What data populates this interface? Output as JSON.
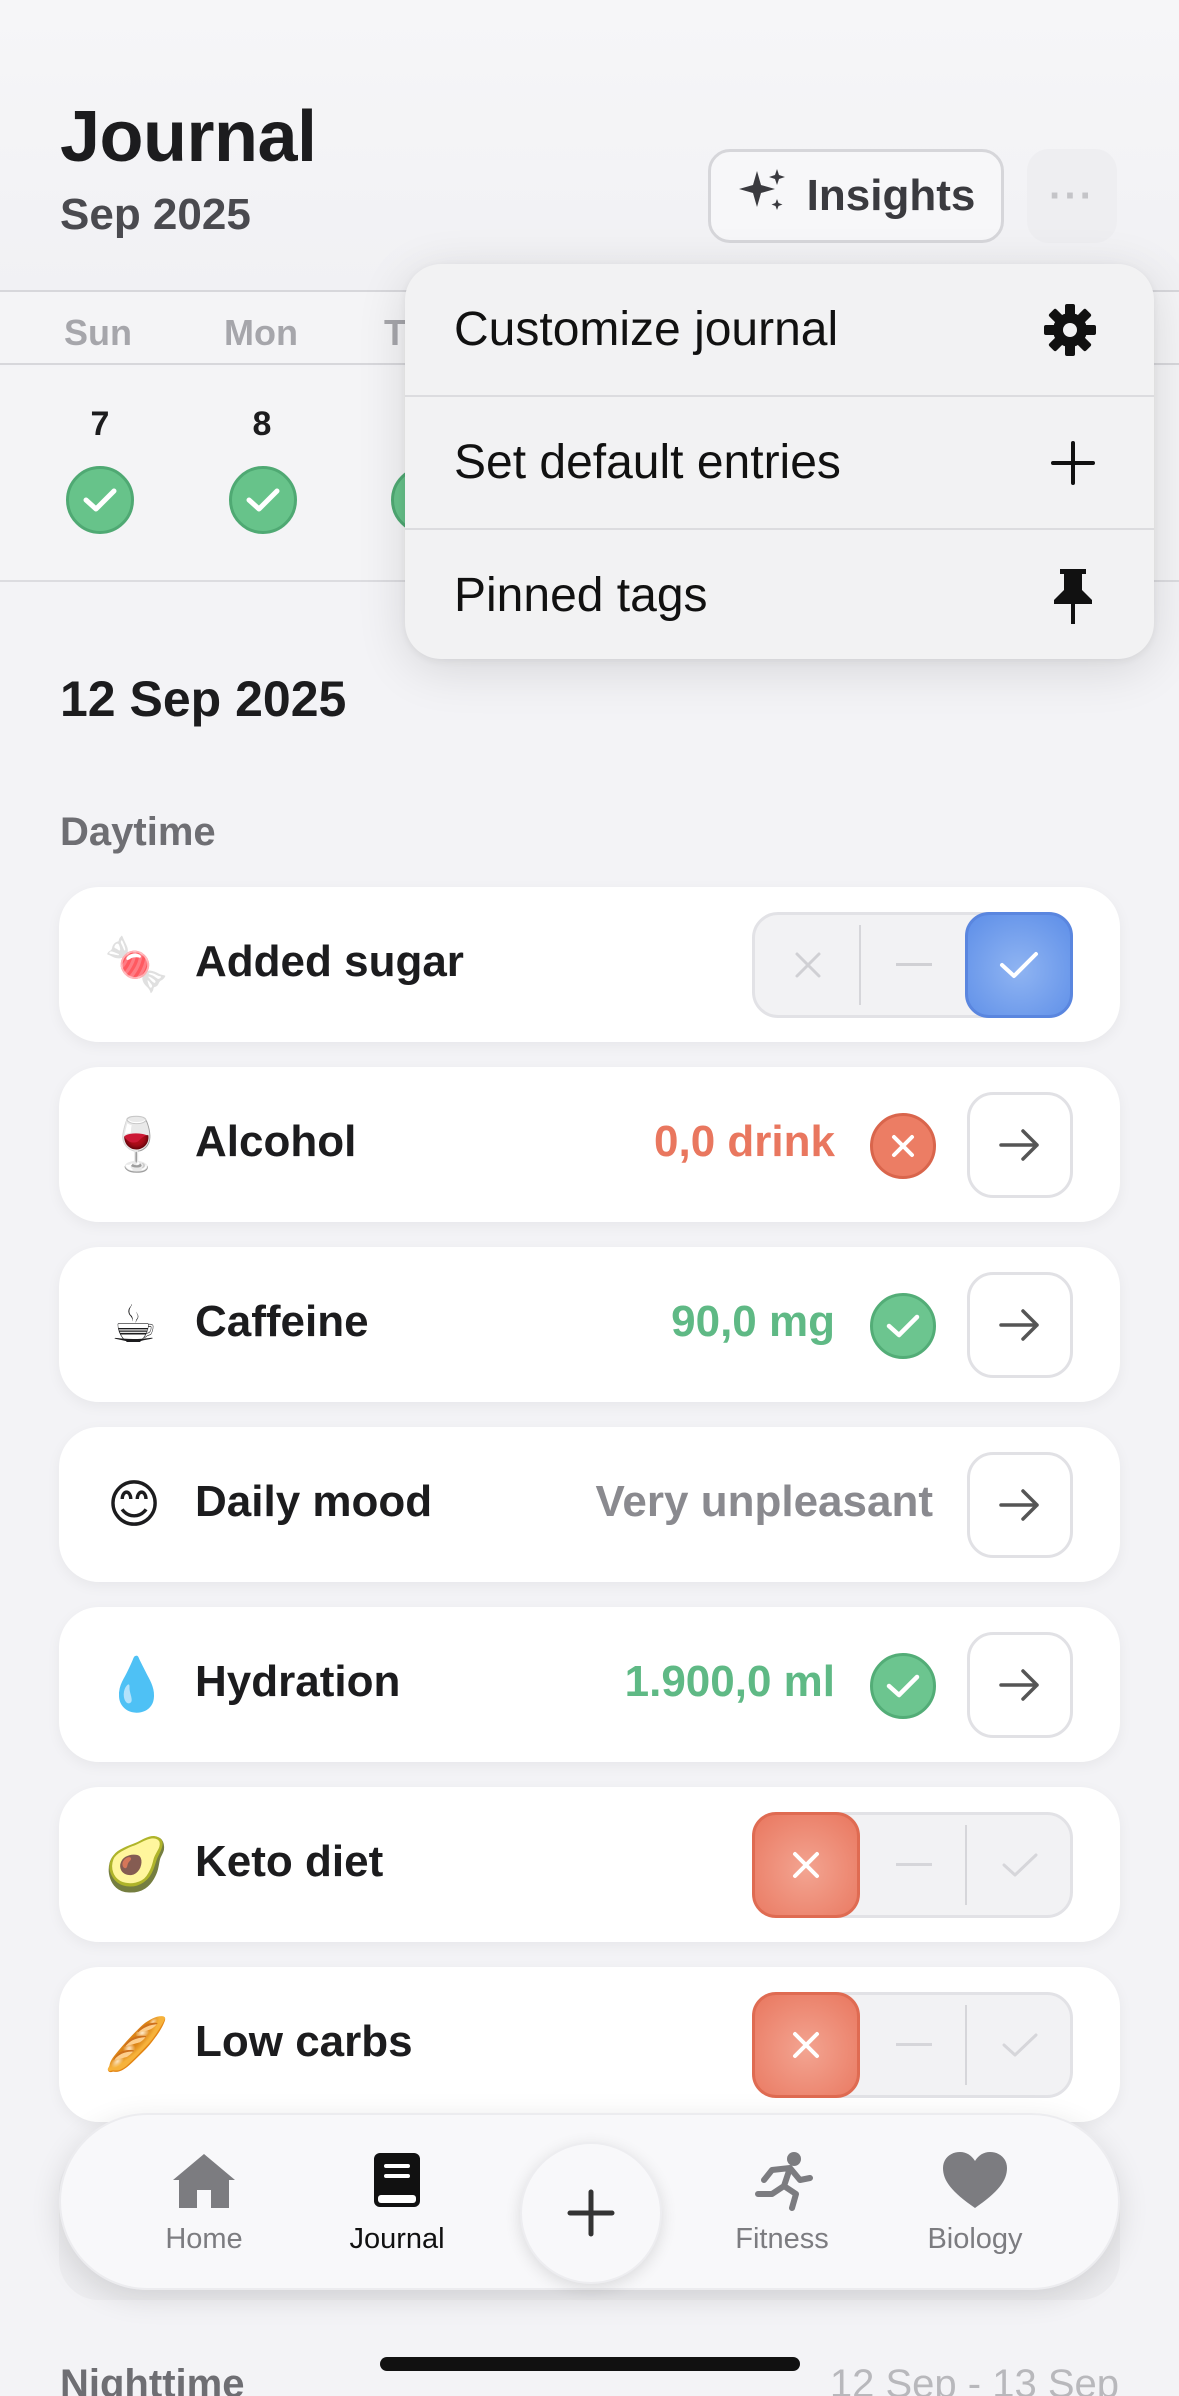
{
  "header": {
    "title": "Journal",
    "subtitle": "Sep 2025",
    "insights_label": "Insights",
    "more_label": "···"
  },
  "week": {
    "day_names": [
      "Sun",
      "Mon",
      "T"
    ],
    "day_numbers": [
      "7",
      "8"
    ]
  },
  "menu": {
    "items": [
      {
        "label": "Customize journal",
        "icon": "gear-icon"
      },
      {
        "label": "Set default entries",
        "icon": "plus-icon"
      },
      {
        "label": "Pinned tags",
        "icon": "pin-icon"
      }
    ]
  },
  "date_heading": "12 Sep 2025",
  "daytime": {
    "label": "Daytime",
    "entries": [
      {
        "emoji": "🍬",
        "label": "Added sugar",
        "control": "tristate",
        "state": "yes"
      },
      {
        "emoji": "🍷",
        "label": "Alcohol",
        "value": "0,0 drink",
        "status": "bad"
      },
      {
        "emoji": "☕",
        "label": "Caffeine",
        "value": "90,0 mg",
        "status": "good"
      },
      {
        "emoji": "😊",
        "label": "Daily mood",
        "value": "Very unpleasant"
      },
      {
        "emoji": "💧",
        "label": "Hydration",
        "value": "1.900,0 ml",
        "status": "good"
      },
      {
        "emoji": "🥑",
        "label": "Keto diet",
        "control": "tristate",
        "state": "no"
      },
      {
        "emoji": "🥖",
        "label": "Low carbs",
        "control": "tristate",
        "state": "no"
      }
    ]
  },
  "tabbar": {
    "items": [
      {
        "label": "Home",
        "icon": "home-icon"
      },
      {
        "label": "Journal",
        "icon": "journal-icon",
        "active": true
      },
      {
        "label": "Fitness",
        "icon": "running-icon"
      },
      {
        "label": "Biology",
        "icon": "heart-icon"
      }
    ],
    "add_icon": "plus-icon"
  },
  "nighttime": {
    "label": "Nighttime",
    "range": "12 Sep - 13 Sep"
  },
  "colors": {
    "good": "#67c38a",
    "bad": "#e9775f",
    "accent_blue": "#5d8ee8",
    "neutral_value": "#8a8a8f"
  }
}
